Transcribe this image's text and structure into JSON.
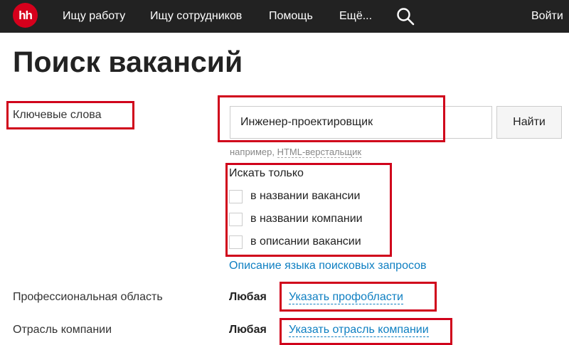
{
  "nav": {
    "logo": "hh",
    "links": [
      "Ищу работу",
      "Ищу сотрудников",
      "Помощь",
      "Ещё..."
    ],
    "login": "Войти"
  },
  "page": {
    "title": "Поиск вакансий"
  },
  "keywords": {
    "label": "Ключевые слова",
    "value": "Инженер-проектировщик",
    "find_button": "Найти",
    "hint_prefix": "например,",
    "hint_example": "HTML-верстальщик"
  },
  "search_only": {
    "title": "Искать только",
    "options": [
      "в названии вакансии",
      "в названии компании",
      "в описании вакансии"
    ]
  },
  "query_language_link": "Описание языка поисковых запросов",
  "prof_area": {
    "label": "Профессиональная область",
    "value": "Любая",
    "link": "Указать профобласти"
  },
  "industry": {
    "label": "Отрасль компании",
    "value": "Любая",
    "link": "Указать отрасль компании"
  },
  "colors": {
    "header_bg": "#222222",
    "brand_red": "#d6001c",
    "annotation_red": "#d0021b",
    "link_blue": "#0e7fc2"
  },
  "icons": {
    "search": "search-icon"
  }
}
